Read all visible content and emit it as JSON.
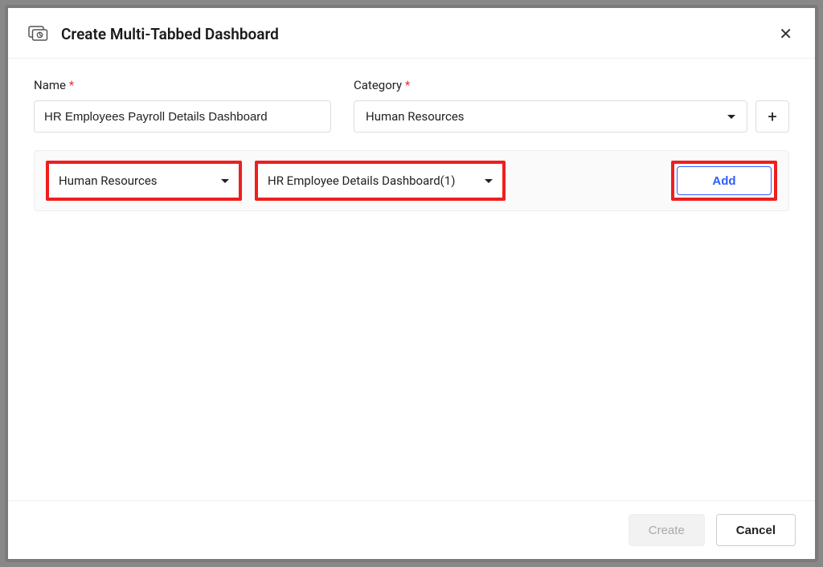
{
  "header": {
    "title": "Create Multi-Tabbed Dashboard"
  },
  "form": {
    "name_label": "Name",
    "name_value": "HR Employees Payroll Details Dashboard",
    "category_label": "Category",
    "category_value": "Human Resources"
  },
  "tab_row": {
    "group_value": "Human Resources",
    "dashboard_value": "HR Employee Details Dashboard(1)",
    "add_label": "Add"
  },
  "footer": {
    "create_label": "Create",
    "cancel_label": "Cancel"
  }
}
